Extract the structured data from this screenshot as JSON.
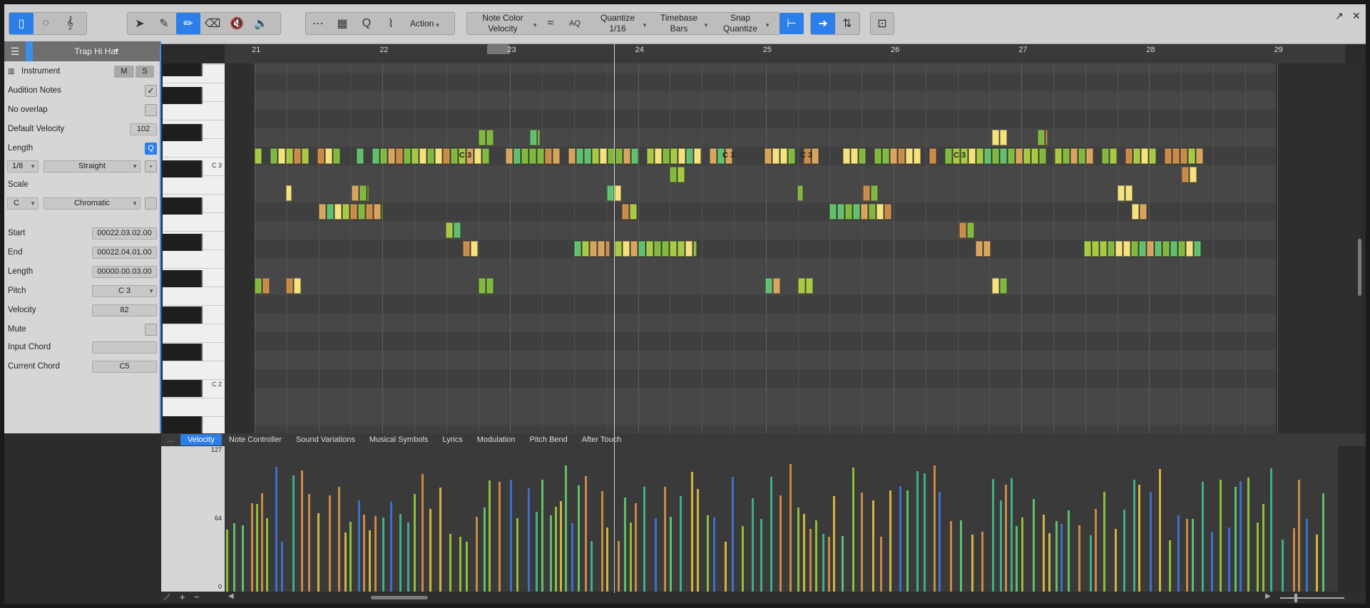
{
  "toolbar": {
    "action_label": "Action",
    "note_color_label": "Note Color",
    "note_color_value": "Velocity",
    "aq_label": "AQ",
    "quantize_label": "Quantize",
    "quantize_value": "1/16",
    "timebase_label": "Timebase",
    "timebase_value": "Bars",
    "snap_label": "Snap",
    "snap_value": "Quantize"
  },
  "inspector": {
    "track_name": "Trap Hi Hat",
    "instrument_label": "Instrument",
    "mute_btn": "M",
    "solo_btn": "S",
    "audition_notes": "Audition Notes",
    "no_overlap": "No overlap",
    "default_velocity_label": "Default Velocity",
    "default_velocity": "102",
    "length_label": "Length",
    "length_q": "Q",
    "length_value": "1/8",
    "length_mode": "Straight",
    "scale_label": "Scale",
    "scale_root": "C",
    "scale_type": "Chromatic",
    "start_label": "Start",
    "start": "00022.03.02.00",
    "end_label": "End",
    "end": "00022.04.01.00",
    "note_length_label": "Length",
    "note_length": "00000.00.03.00",
    "pitch_label": "Pitch",
    "pitch": "C 3",
    "velocity_label": "Velocity",
    "velocity": "82",
    "mute_label": "Mute",
    "input_chord_label": "Input Chord",
    "input_chord": "",
    "current_chord_label": "Current Chord",
    "current_chord": "C5"
  },
  "ruler": [
    "21",
    "22",
    "23",
    "24",
    "25",
    "26",
    "27",
    "28",
    "29"
  ],
  "key_labels": {
    "c3": "C 3",
    "c2": "C 2"
  },
  "note_labels": [
    "C 3",
    "C 3",
    "C 3",
    "C 3"
  ],
  "tabs": [
    "Velocity",
    "Note Controller",
    "Sound Variations",
    "Musical Symbols",
    "Lyrics",
    "Modulation",
    "Pitch Bend",
    "After Touch"
  ],
  "velocity_scale": {
    "max": "127",
    "mid": "64",
    "min": "0"
  },
  "colors": {
    "accent": "#2c7fe8",
    "note_yellow": "#f6e27a",
    "note_orange": "#c98a45",
    "note_green": "#7fb83a",
    "note_blue": "#3f6fc8"
  }
}
